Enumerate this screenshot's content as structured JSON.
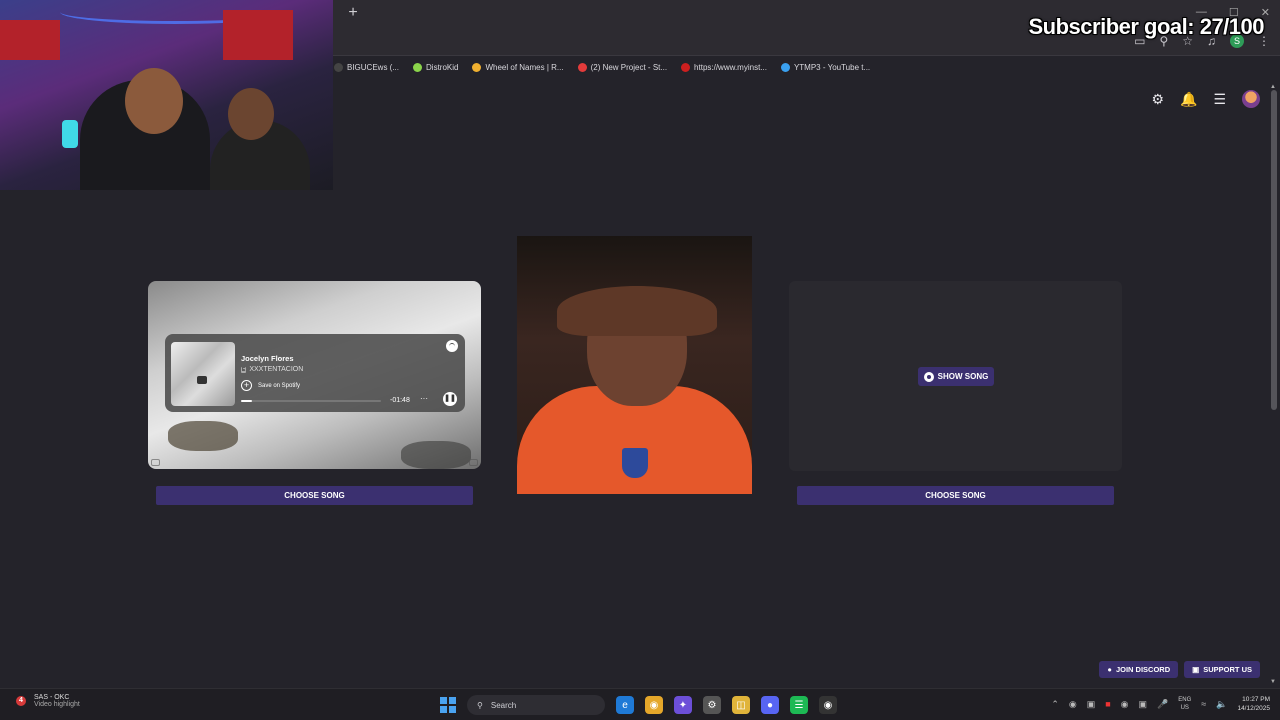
{
  "overlay": {
    "subscriber_goal": "Subscriber goal: 27/100"
  },
  "browser": {
    "new_tab": "+",
    "bookmarks": [
      {
        "label": "BIGUCEws (...",
        "color": "#444444"
      },
      {
        "label": "DistroKid",
        "color": "#8bd44b"
      },
      {
        "label": "Wheel of Names | R...",
        "color": "#f0b030"
      },
      {
        "label": "(2) New Project - St...",
        "color": "#e33b3b"
      },
      {
        "label": "https://www.myinst...",
        "color": "#cc1f1f"
      },
      {
        "label": "YTMP3 - YouTube t...",
        "color": "#3aa0f0"
      }
    ],
    "profile_initial": "S"
  },
  "player": {
    "track": "Jocelyn Flores",
    "explicit": "E",
    "artist": "XXXTENTACION",
    "save_label": "Save on Spotify",
    "time_remaining": "-01:48",
    "more": "···",
    "progress": 0.08
  },
  "buttons": {
    "choose_song_left": "CHOOSE SONG",
    "choose_song_right": "CHOOSE SONG",
    "show_song": "SHOW SONG",
    "join_discord": "JOIN DISCORD",
    "support_us": "SUPPORT US"
  },
  "taskbar": {
    "alert_count": "4",
    "notif_title": "SAS - OKC",
    "notif_sub": "Video highlight",
    "search_placeholder": "Search",
    "lang_top": "ENG",
    "lang_bottom": "US",
    "time": "10:27 PM",
    "date": "14/12/2025"
  },
  "colors": {
    "accent_button": "#3b3070",
    "background": "#24232a"
  }
}
